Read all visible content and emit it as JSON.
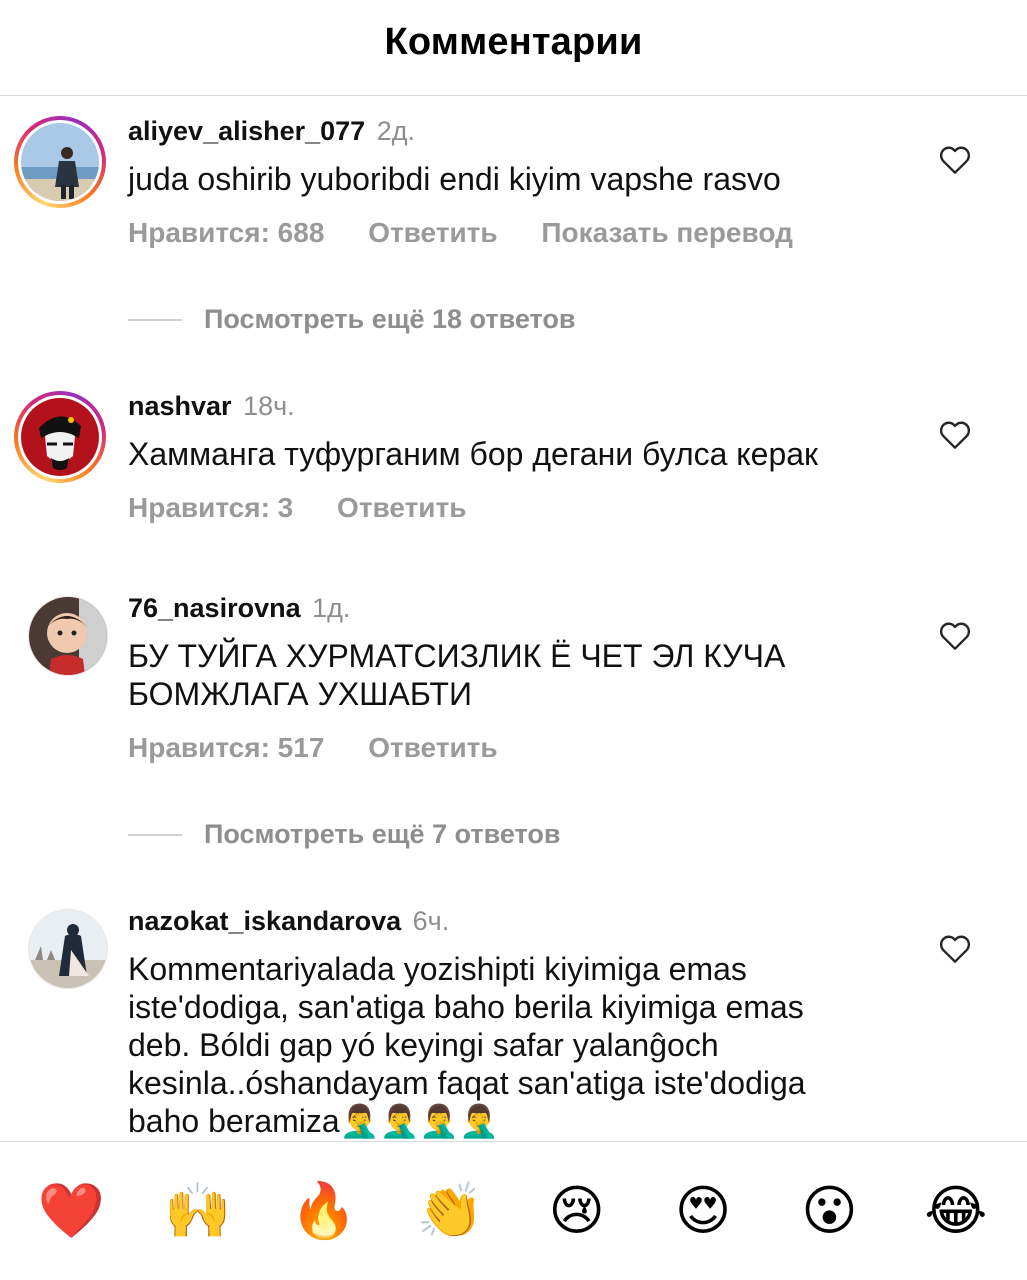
{
  "header": {
    "title": "Комментарии"
  },
  "comments": [
    {
      "username": "aliyev_alisher_077",
      "time": "2д.",
      "text": "juda oshirib yuboribdi endi kiyim vapshe rasvo",
      "likes": "Нравится: 688",
      "reply": "Ответить",
      "translate": "Показать перевод",
      "view_replies": "Посмотреть ещё 18 ответов"
    },
    {
      "username": "nashvar",
      "time": "18ч.",
      "text": "Хамманга туфурганим бор дегани булса керак",
      "likes": "Нравится: 3",
      "reply": "Ответить"
    },
    {
      "username": "76_nasirovna",
      "time": "1д.",
      "text_lines": [
        "БУ ТУЙГА ХУРМАТСИЗЛИК  Ё ЧЕТ ЭЛ КУЧА",
        "БОМЖЛАГА УХШАБТИ"
      ],
      "likes": "Нравится: 517",
      "reply": "Ответить",
      "view_replies": "Посмотреть ещё 7 ответов"
    },
    {
      "username": "nazokat_iskandarova",
      "time": "6ч.",
      "text_lines": [
        "Kommentariyalada yozishipti kiyimiga emas",
        "iste'dodiga, san'atiga baho berila kiyimiga emas",
        "deb. Bóldi gap yó keyingi safar yalanĝoch",
        "kesinla..óshandayam faqat san'atiga iste'dodiga",
        "baho beramiza🤦‍♂️🤦‍♂️🤦‍♂️🤦‍♂️"
      ]
    }
  ],
  "reactions": [
    "❤️",
    "🙌",
    "🔥",
    "👏",
    "😢",
    "😍",
    "😮",
    "😂"
  ],
  "icons": {
    "like": "heart-outline-icon"
  },
  "colors": {
    "muted": "#8e8e8e",
    "ring_start": "#feda75",
    "ring_end": "#962fbf"
  }
}
